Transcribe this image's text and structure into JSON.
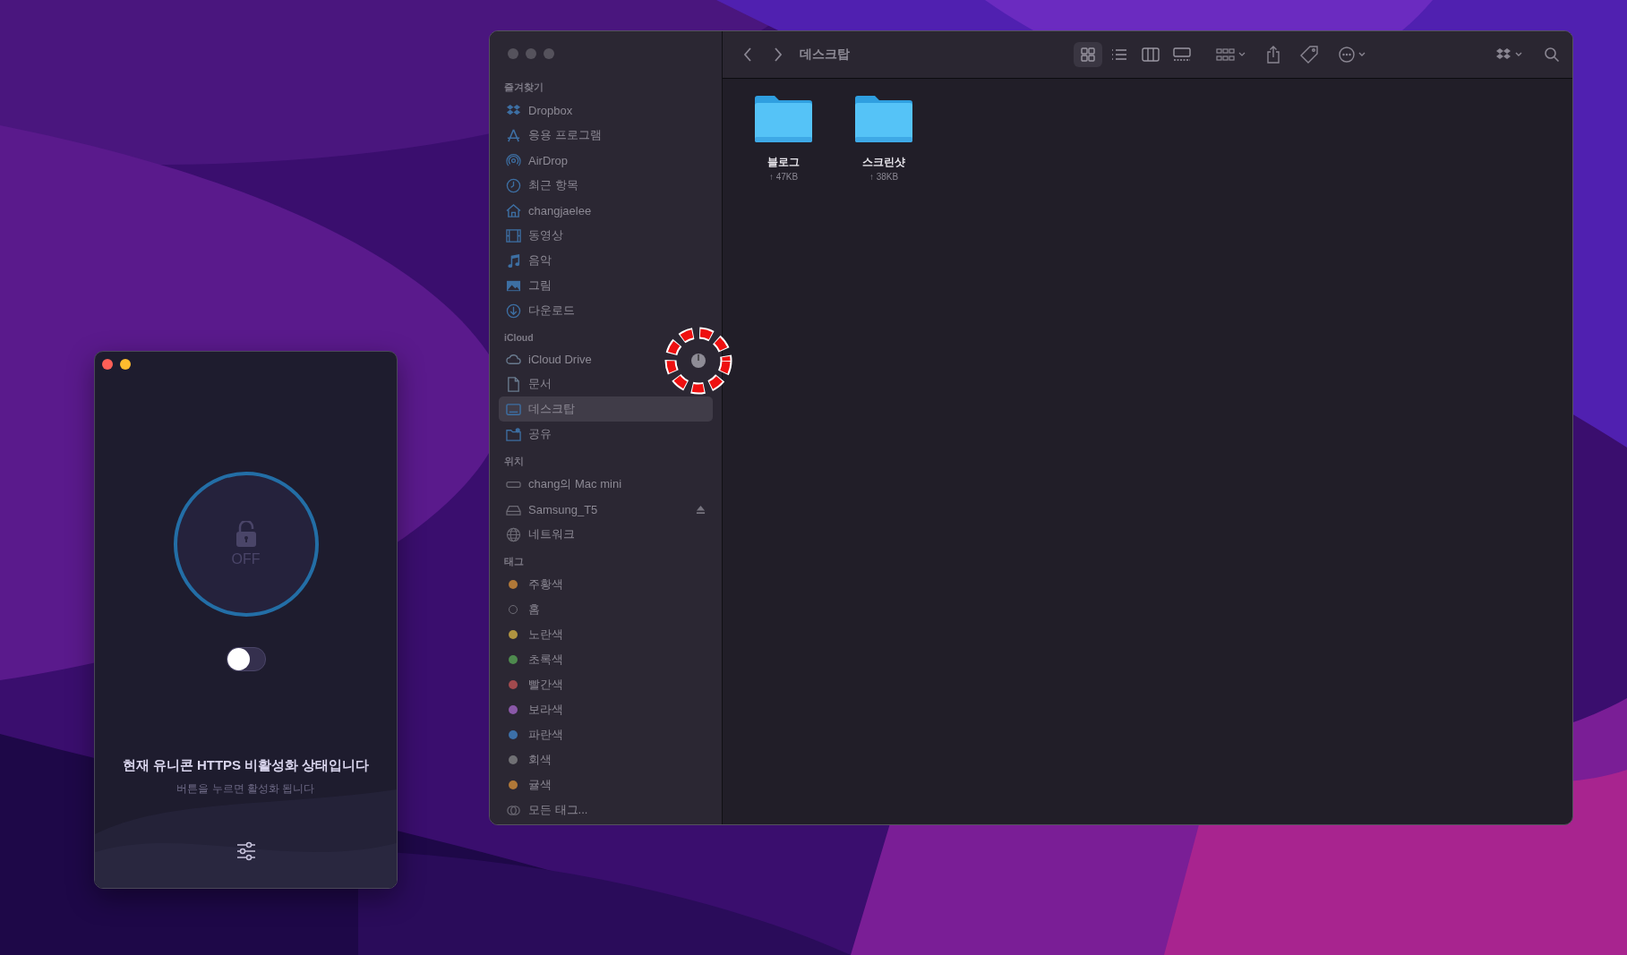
{
  "app": {
    "traffic_lights": [
      {
        "color": "#fe5f57"
      },
      {
        "color": "#febc2e"
      }
    ],
    "status": "OFF",
    "toggle_on": false,
    "message": "현재 유니콘 HTTPS 비활성화 상태입니다",
    "hint": "버튼을 누르면 활성화 됩니다"
  },
  "finder": {
    "title": "데스크탑",
    "views": [
      {
        "kind": "icons",
        "selected": true
      },
      {
        "kind": "list",
        "selected": false
      },
      {
        "kind": "columns",
        "selected": false
      },
      {
        "kind": "gallery",
        "selected": false
      }
    ],
    "sidebar": [
      {
        "heading": "즐겨찾기",
        "items": [
          {
            "kind": "dropbox",
            "label": "Dropbox",
            "selected": false
          },
          {
            "kind": "apps",
            "label": "응용 프로그램",
            "selected": false
          },
          {
            "kind": "airdrop",
            "label": "AirDrop",
            "selected": false
          },
          {
            "kind": "clock",
            "label": "최근 항목",
            "selected": false
          },
          {
            "kind": "home",
            "label": "changjaelee",
            "selected": false
          },
          {
            "kind": "film",
            "label": "동영상",
            "selected": false
          },
          {
            "kind": "music",
            "label": "음악",
            "selected": false
          },
          {
            "label": "그림",
            "selected": false
          },
          {
            "kind": "download",
            "label": "다운로드",
            "selected": false
          }
        ]
      },
      {
        "heading": "iCloud",
        "items": [
          {
            "kind": "cloud",
            "label": "iCloud Drive",
            "selected": false
          },
          {
            "kind": "doc",
            "label": "문서",
            "selected": false
          },
          {
            "kind": "desktop",
            "label": "데스크탑",
            "selected": true
          },
          {
            "kind": "shared",
            "label": "공유",
            "selected": false
          }
        ]
      },
      {
        "heading": "위치",
        "items": [
          {
            "kind": "mac",
            "label": "chang의 Mac mini",
            "selected": false
          },
          {
            "kind": "drive",
            "label": "Samsung_T5",
            "selected": false,
            "ejectable": true
          },
          {
            "kind": "globe",
            "label": "네트워크",
            "selected": false
          }
        ]
      },
      {
        "heading": "태그",
        "items": [
          {
            "kind": "tag",
            "label": "주황색",
            "color": "#b07838",
            "selected": false
          },
          {
            "kind": "tag-empty",
            "label": "홈",
            "selected": false
          },
          {
            "kind": "tag",
            "label": "노란색",
            "color": "#b09440",
            "selected": false
          },
          {
            "kind": "tag",
            "label": "초록색",
            "color": "#4e8a4e",
            "selected": false
          },
          {
            "kind": "tag",
            "label": "빨간색",
            "color": "#a24a4e",
            "selected": false
          },
          {
            "kind": "tag",
            "label": "보라색",
            "color": "#8a58a8",
            "selected": false
          },
          {
            "kind": "tag",
            "label": "파란색",
            "color": "#3c70a8",
            "selected": false
          },
          {
            "kind": "tag",
            "label": "회색",
            "color": "#707074",
            "selected": false
          },
          {
            "kind": "tag",
            "label": "귤색",
            "color": "#b07838",
            "selected": false
          },
          {
            "kind": "all-tags",
            "label": "모든 태그...",
            "selected": false
          }
        ]
      }
    ],
    "files": [
      {
        "name": "블로그",
        "size": "↑ 47KB"
      },
      {
        "name": "스크린샷",
        "size": "↑ 38KB"
      }
    ]
  }
}
